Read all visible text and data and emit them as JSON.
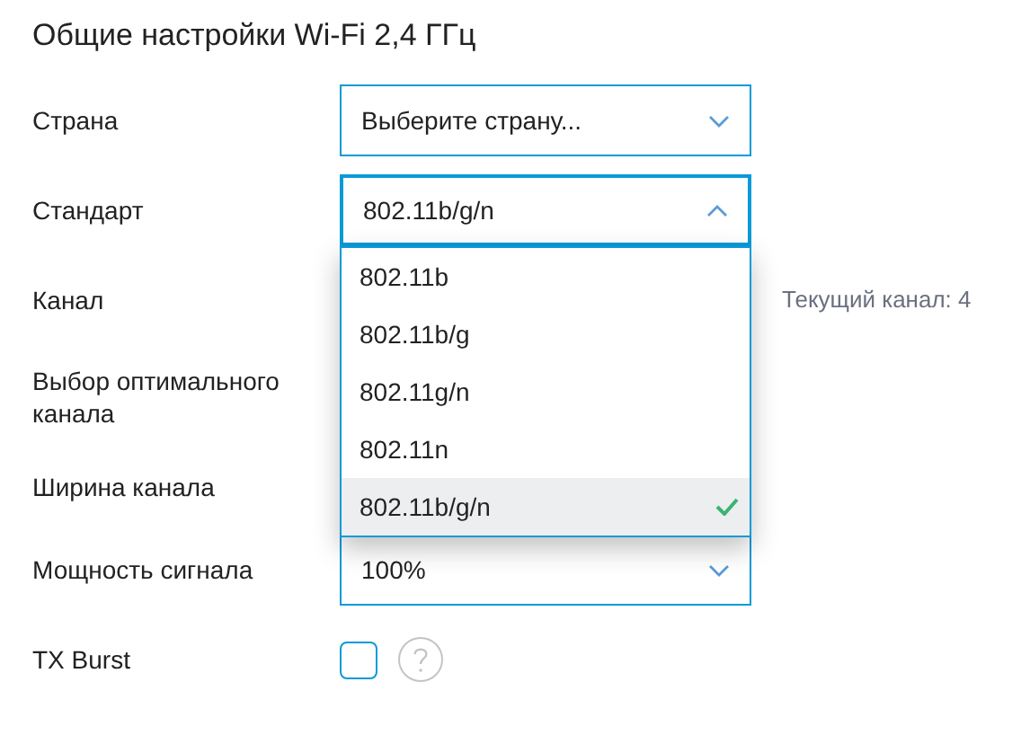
{
  "title": "Общие настройки Wi-Fi 2,4 ГГц",
  "rows": [
    {
      "label": "Страна",
      "kind": "select",
      "value": "Выберите страну...",
      "expanded": false
    },
    {
      "label": "Стандарт",
      "kind": "select",
      "value": "802.11b/g/n",
      "expanded": true,
      "options": [
        {
          "label": "802.11b",
          "selected": false
        },
        {
          "label": "802.11b/g",
          "selected": false
        },
        {
          "label": "802.11g/n",
          "selected": false
        },
        {
          "label": "802.11n",
          "selected": false
        },
        {
          "label": "802.11b/g/n",
          "selected": true
        }
      ]
    },
    {
      "label": "Канал",
      "kind": "hidden",
      "note": "Текущий канал: 4"
    },
    {
      "label": "Выбор оптимального канала",
      "kind": "hidden"
    },
    {
      "label": "Ширина канала",
      "kind": "hidden"
    },
    {
      "label": "Мощность сигнала",
      "kind": "select",
      "value": "100%",
      "expanded": false
    },
    {
      "label": "TX Burst",
      "kind": "checkbox",
      "checked": false
    }
  ]
}
